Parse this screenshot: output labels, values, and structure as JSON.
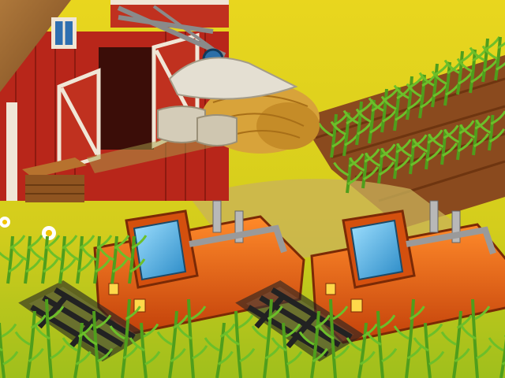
{
  "scene": {
    "type": "farm-game-artwork",
    "palette": {
      "grass_light": "#e6d21c",
      "grass": "#b9c51e",
      "field_dirt": "#8a4a1e",
      "crop_green": "#4f9e1c",
      "barn_red": "#b8261a",
      "harvester_orange": "#ea5a0e",
      "cab_glass": "#4cb5ea",
      "hay": "#d8a33a"
    },
    "objects": {
      "barn": "red-barn",
      "crate": "wooden-crate",
      "hay": "hay-bales",
      "pulley": "pulley-hook",
      "sacks": "grain-sacks",
      "field": "crop-field",
      "harvesters": [
        "harvester-left",
        "harvester-right"
      ]
    }
  }
}
